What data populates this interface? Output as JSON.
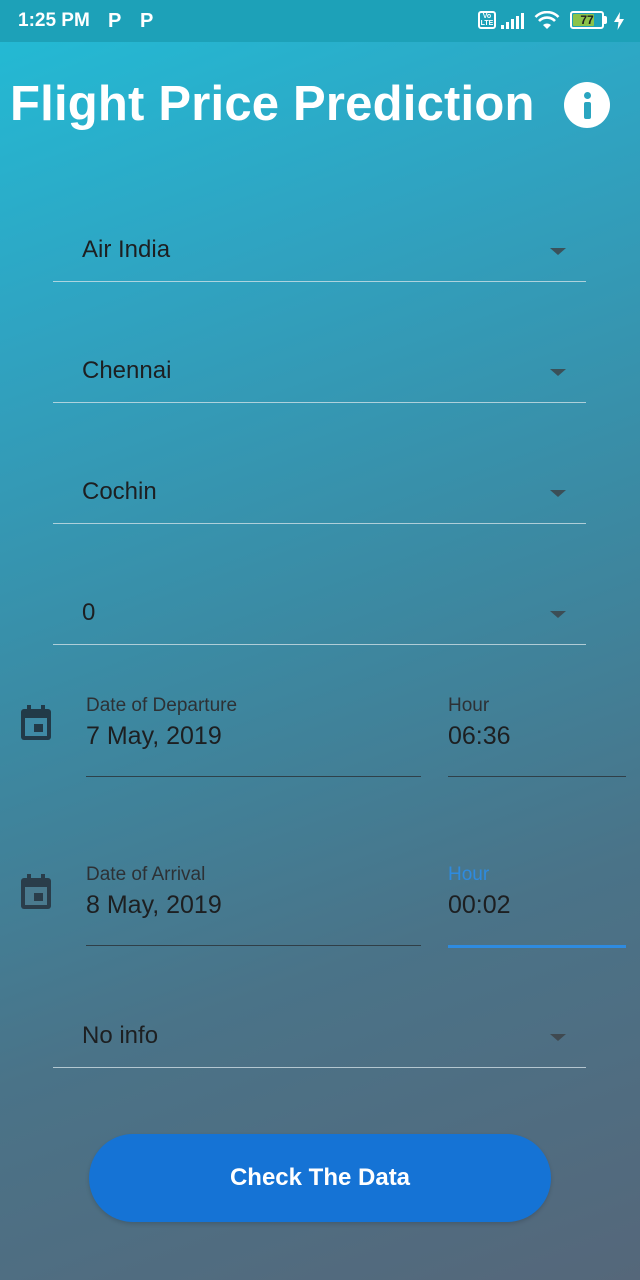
{
  "status_bar": {
    "time": "1:25 PM",
    "notification_icons": [
      "P",
      "P"
    ],
    "volte_label": "Vo LTE",
    "battery_level": "77",
    "battery_color": "#8bc34a"
  },
  "header": {
    "title": "Flight Price Prediction",
    "info_icon": "info-icon"
  },
  "form": {
    "airline": {
      "value": "Air India"
    },
    "source": {
      "value": "Chennai"
    },
    "destination": {
      "value": "Cochin"
    },
    "stops": {
      "value": "0"
    },
    "departure": {
      "date_label": "Date of Departure",
      "date_value": "7 May, 2019",
      "hour_label": "Hour",
      "hour_value": "06:36"
    },
    "arrival": {
      "date_label": "Date of Arrival",
      "date_value": "8 May, 2019",
      "hour_label": "Hour",
      "hour_value": "00:02"
    },
    "additional_info": {
      "value": "No info"
    },
    "submit_label": "Check The Data"
  },
  "colors": {
    "accent": "#1573d5",
    "focus": "#2e8be0",
    "gradient_top": "#22bcd6",
    "gradient_bottom": "#55677a"
  }
}
